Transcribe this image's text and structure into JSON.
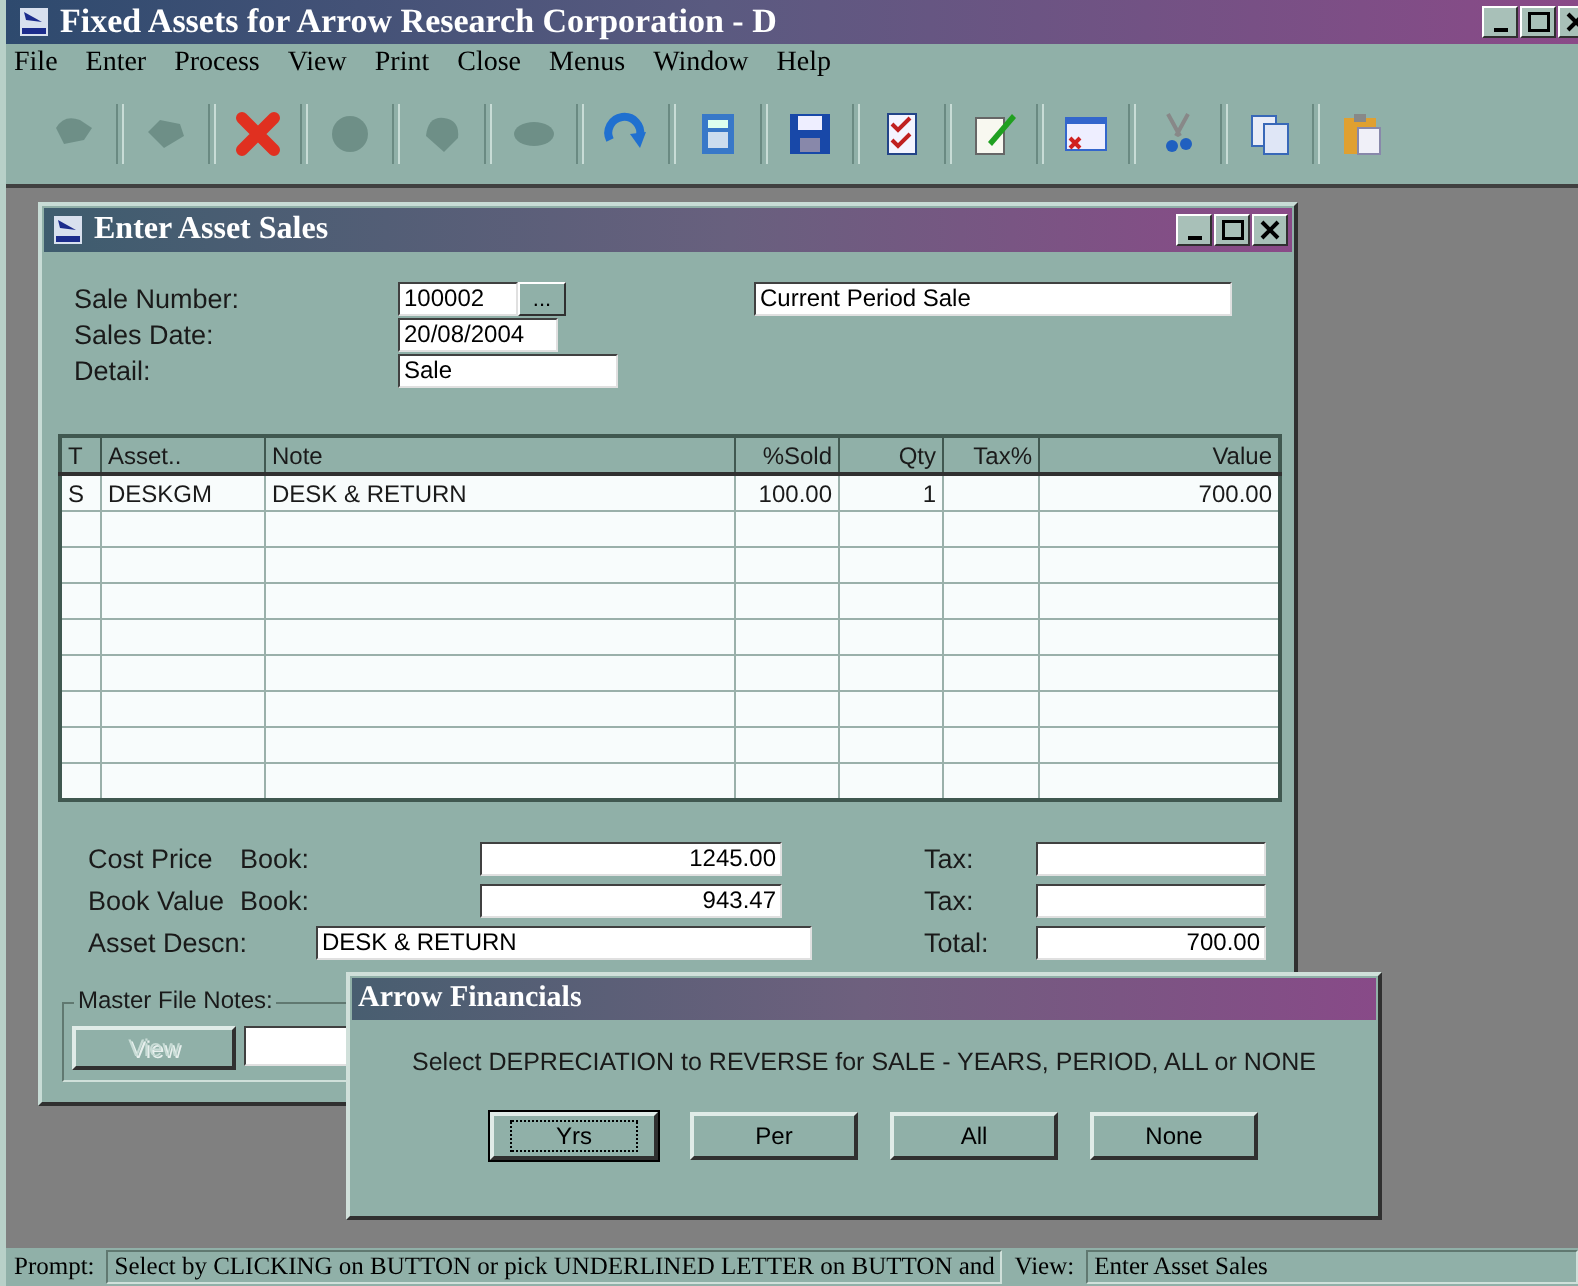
{
  "window": {
    "title": "Fixed Assets for Arrow Research Corporation - D"
  },
  "menu": [
    "File",
    "Enter",
    "Process",
    "View",
    "Print",
    "Close",
    "Menus",
    "Window",
    "Help"
  ],
  "toolbar": [
    {
      "disabled": true
    },
    {
      "disabled": true
    },
    {
      "disabled": false
    },
    {
      "disabled": true
    },
    {
      "disabled": true
    },
    {
      "disabled": true
    },
    {
      "disabled": false
    },
    {
      "disabled": false
    },
    {
      "disabled": false
    },
    {
      "disabled": false
    },
    {
      "disabled": false
    },
    {
      "disabled": false
    },
    {
      "disabled": false
    },
    {
      "disabled": false
    },
    {
      "disabled": false
    }
  ],
  "child_window": {
    "title": "Enter Asset Sales",
    "sale_number": {
      "label": "Sale Number:",
      "value": "100002",
      "button": "..."
    },
    "sales_date": {
      "label": "Sales Date:",
      "value": "20/08/2004"
    },
    "detail": {
      "label": "Detail:",
      "value": "Sale"
    },
    "sale_type": "Current Period Sale",
    "table": {
      "columns": [
        "T",
        "Asset..",
        "Note",
        "%Sold",
        "Qty",
        "Tax%",
        "Value"
      ],
      "rows": [
        [
          "S",
          "DESKGM",
          "DESK & RETURN",
          "100.00",
          "1",
          "",
          "700.00"
        ]
      ]
    },
    "cost_price": {
      "label": "Cost Price",
      "sublabel": "Book:",
      "value": "1245.00"
    },
    "book_value": {
      "label": "Book Value",
      "sublabel": "Book:",
      "value": "943.47"
    },
    "asset_descn": {
      "label": "Asset Descn:",
      "value": "DESK & RETURN"
    },
    "totals": [
      {
        "label": "Tax:"
      },
      {
        "label": "Tax:"
      },
      {
        "label": "Total:",
        "value": "700.00"
      }
    ],
    "master_file_notes": {
      "label": "Master File Notes:",
      "view_button": {
        "label": "View",
        "disabled": true
      }
    }
  },
  "dialog": {
    "title": "Arrow Financials",
    "message": "Select DEPRECIATION to REVERSE for SALE - YEARS, PERIOD, ALL or NONE",
    "buttons": [
      {
        "label": "Yrs",
        "selected": true
      },
      {
        "label": "Per",
        "selected": false
      },
      {
        "label": "All",
        "selected": false
      },
      {
        "label": "None",
        "selected": false
      }
    ]
  },
  "status_bar": {
    "prompt_label": "Prompt:",
    "prompt": "Select by CLICKING on BUTTON or pick UNDERLINED LETTER on BUTTON and",
    "view_label": "View:",
    "view": "Enter Asset Sales"
  }
}
